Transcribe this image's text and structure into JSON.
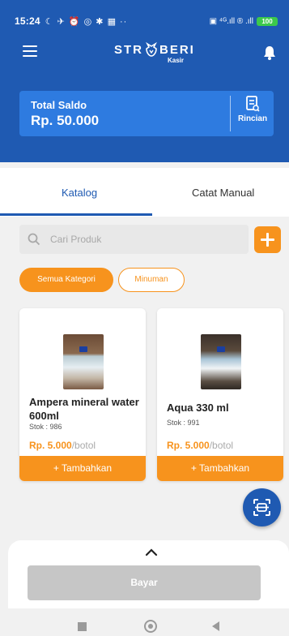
{
  "status_bar": {
    "time": "15:24",
    "glyphs": "☾ ✈ ⏰ ◎ ✱ ▦ ··",
    "right_glyphs": "▣ ⁴ᴳ.ıll ® .ıll",
    "battery": "100"
  },
  "app": {
    "logo_left": "STR",
    "logo_right": "BERI",
    "logo_sub": "Kasir"
  },
  "saldo": {
    "label": "Total Saldo",
    "value": "Rp. 50.000",
    "rincian_label": "Rincian"
  },
  "tabs": [
    {
      "label": "Katalog",
      "active": true
    },
    {
      "label": "Catat Manual",
      "active": false
    }
  ],
  "search": {
    "placeholder": "Cari Produk"
  },
  "categories": [
    {
      "label": "Semua Kategori",
      "selected": true
    },
    {
      "label": "Minuman",
      "selected": false
    }
  ],
  "products": [
    {
      "name": "Ampera mineral water 600ml",
      "stok": "Stok : 986",
      "price": "Rp. 5.000",
      "unit": "/botol",
      "add_label": "+  Tambahkan"
    },
    {
      "name": "Aqua 330 ml",
      "stok": "Stok : 991",
      "price": "Rp. 5.000",
      "unit": "/botol",
      "add_label": "+  Tambahkan"
    }
  ],
  "footer": {
    "bayar_label": "Bayar"
  },
  "colors": {
    "primary_blue": "#1f5ab2",
    "card_blue": "#2e7be0",
    "accent_orange": "#f7931d",
    "disabled_gray": "#c6c6c6"
  },
  "icons": [
    "hamburger-icon",
    "strawberry-logo-icon",
    "bell-icon",
    "receipt-icon",
    "search-icon",
    "plus-icon",
    "scan-icon",
    "chevron-up-icon"
  ]
}
